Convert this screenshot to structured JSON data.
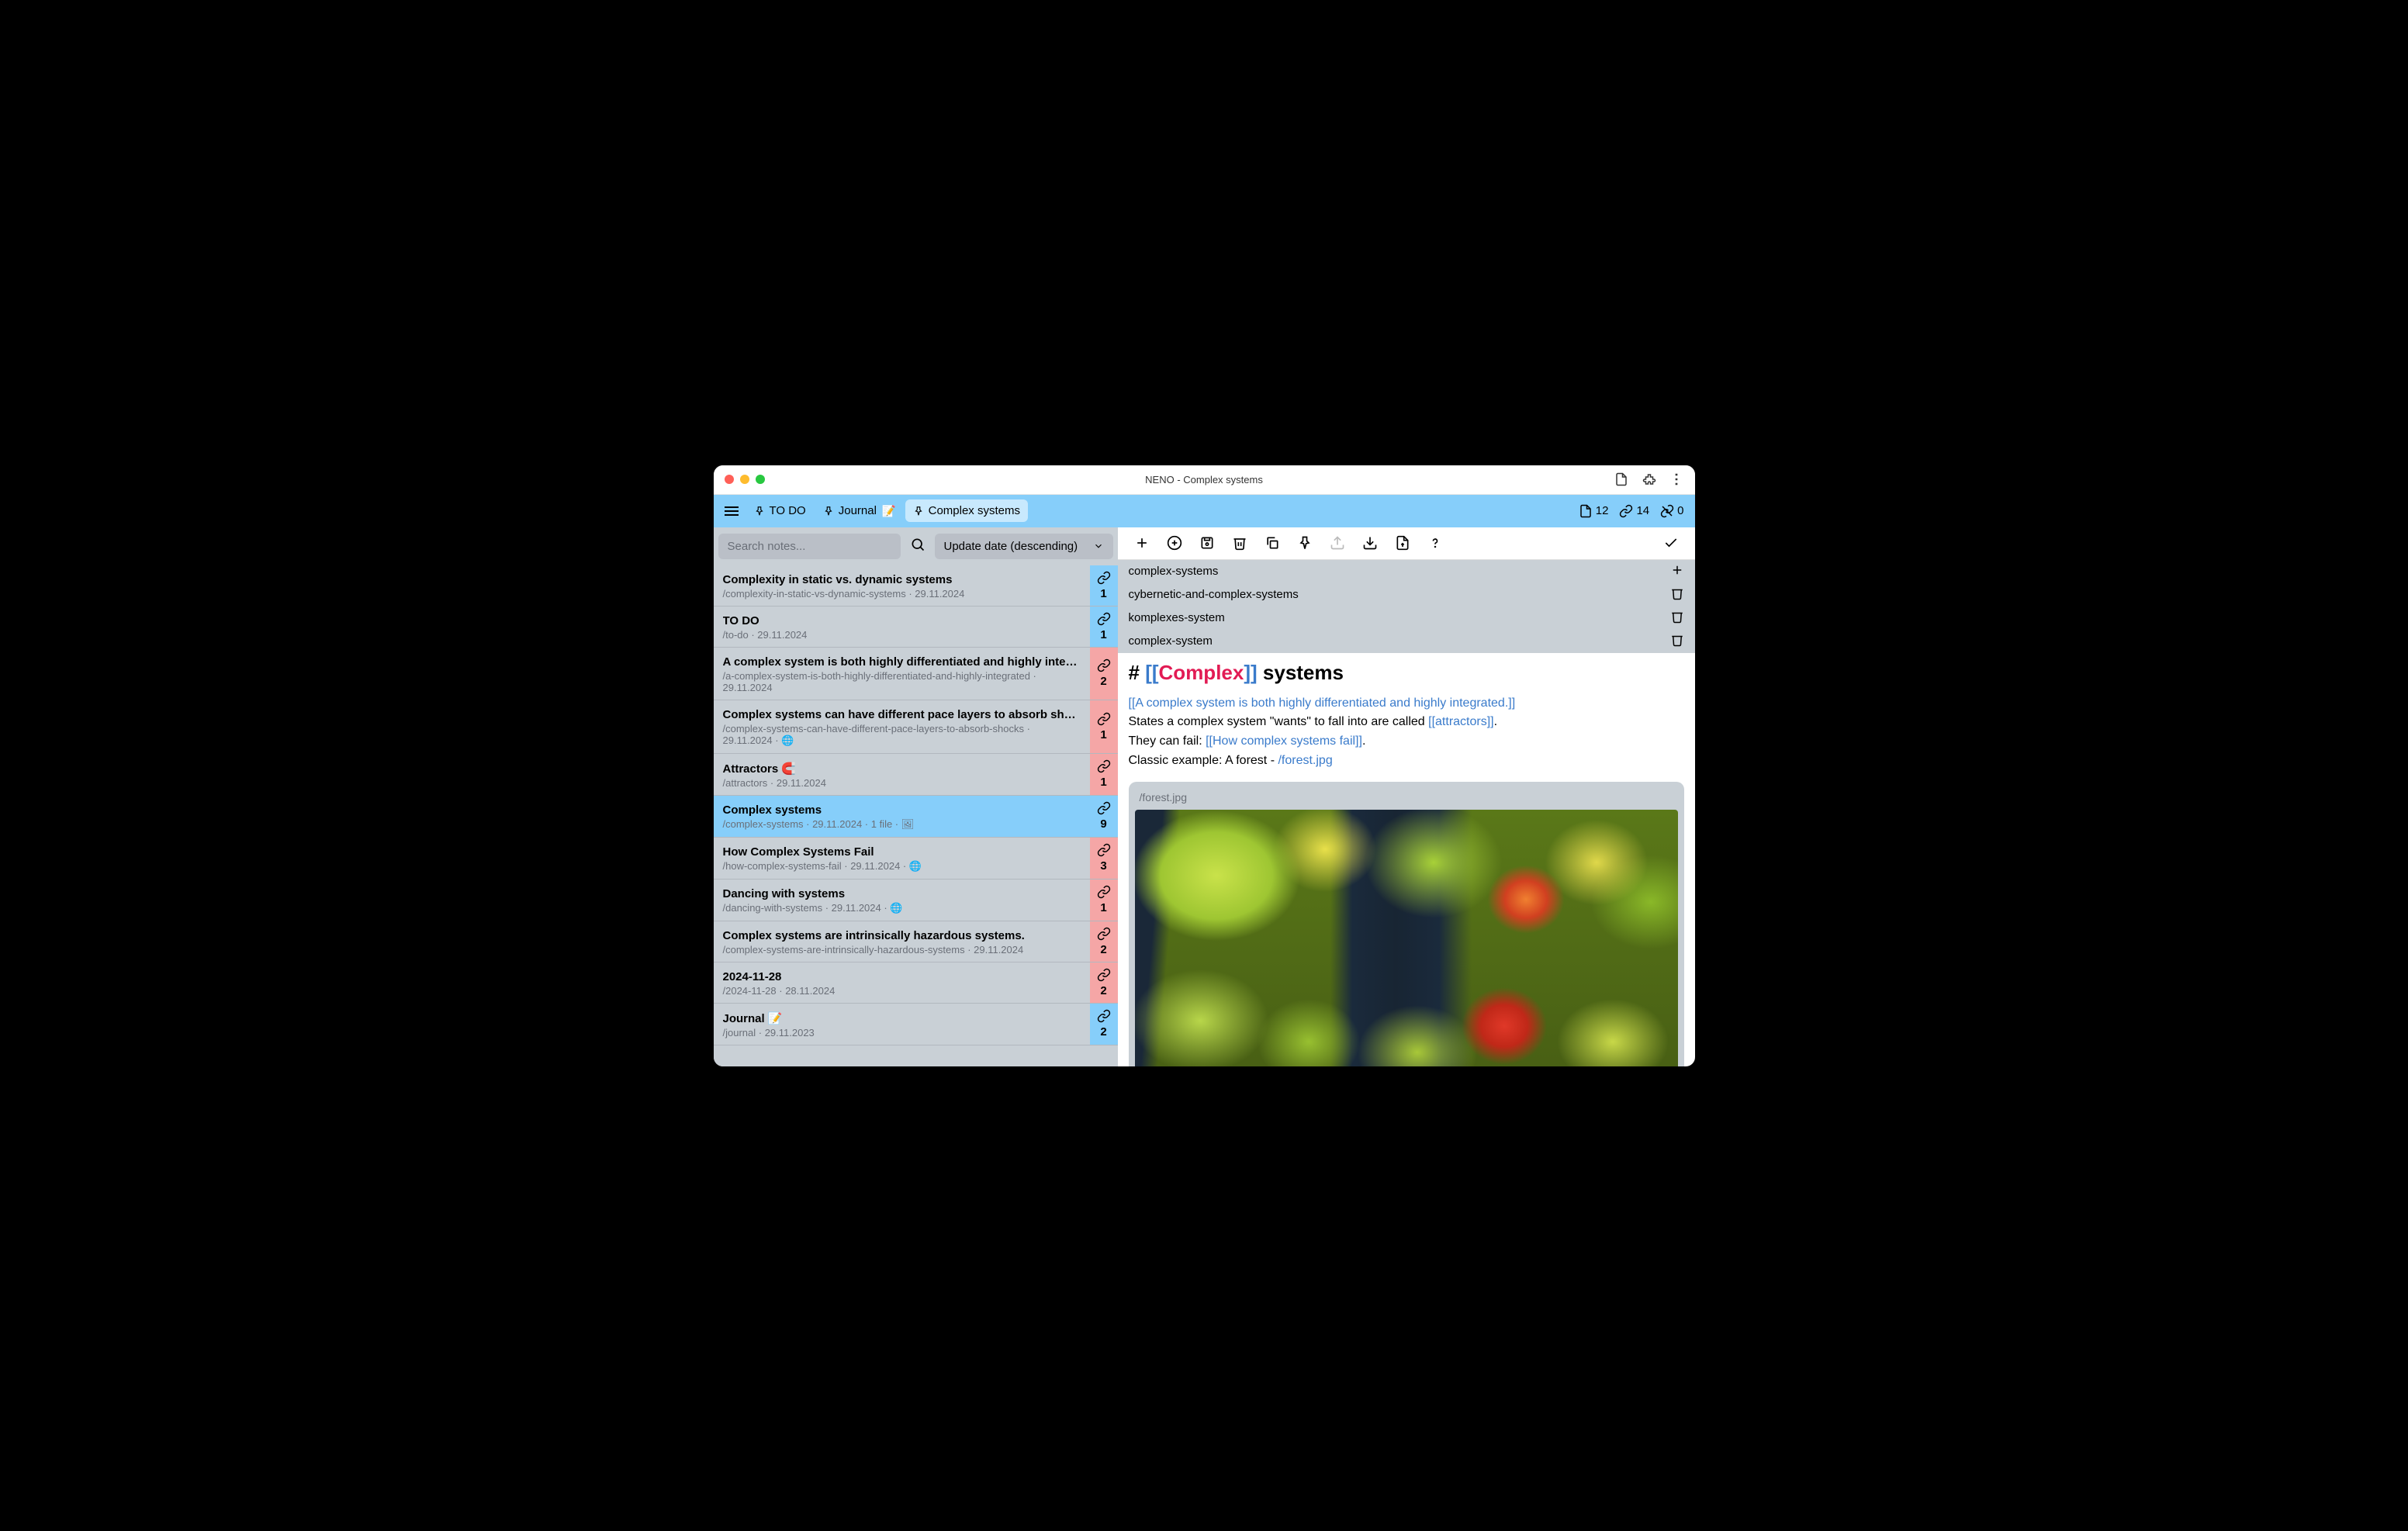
{
  "window_title": "NENO - Complex systems",
  "header": {
    "pins": [
      {
        "label": "TO DO",
        "emoji": ""
      },
      {
        "label": "Journal",
        "emoji": "📝"
      },
      {
        "label": "Complex systems",
        "emoji": "",
        "active": true
      }
    ],
    "stats": {
      "notes": "12",
      "links": "14",
      "broken": "0"
    }
  },
  "search": {
    "placeholder": "Search notes..."
  },
  "sort": {
    "label": "Update date (descending)"
  },
  "notes": [
    {
      "title": "Complexity in static vs. dynamic systems",
      "meta": "/complexity-in-static-vs-dynamic-systems · 29.11.2024",
      "count": "1",
      "badge": "blue"
    },
    {
      "title": "TO DO",
      "meta": "/to-do · 29.11.2024",
      "count": "1",
      "badge": "blue"
    },
    {
      "title": "A complex system is both highly differentiated and highly integrat...",
      "meta": "/a-complex-system-is-both-highly-differentiated-and-highly-integrated · 29.11.2024",
      "count": "2",
      "badge": "red"
    },
    {
      "title": "Complex systems can have different pace layers to absorb shocks.",
      "meta": "/complex-systems-can-have-different-pace-layers-to-absorb-shocks · 29.11.2024 · 🌐",
      "count": "1",
      "badge": "red"
    },
    {
      "title": "Attractors 🧲",
      "meta": "/attractors · 29.11.2024",
      "count": "1",
      "badge": "red"
    },
    {
      "title": "Complex systems",
      "meta": "/complex-systems · 29.11.2024 · 1 file · 🖼",
      "count": "9",
      "badge": "blue",
      "active": true
    },
    {
      "title": "How Complex Systems Fail",
      "meta": "/how-complex-systems-fail · 29.11.2024 · 🌐",
      "count": "3",
      "badge": "red"
    },
    {
      "title": "Dancing with systems",
      "meta": "/dancing-with-systems · 29.11.2024 · 🌐",
      "count": "1",
      "badge": "red"
    },
    {
      "title": "Complex systems are intrinsically hazardous systems.",
      "meta": "/complex-systems-are-intrinsically-hazardous-systems · 29.11.2024",
      "count": "2",
      "badge": "red"
    },
    {
      "title": "2024-11-28",
      "meta": "/2024-11-28 · 28.11.2024",
      "count": "2",
      "badge": "red"
    },
    {
      "title": "Journal 📝",
      "meta": "/journal · 29.11.2023",
      "count": "2",
      "badge": "blue"
    }
  ],
  "aliases": [
    {
      "name": "complex-systems",
      "action": "add"
    },
    {
      "name": "cybernetic-and-complex-systems",
      "action": "delete"
    },
    {
      "name": "komplexes-system",
      "action": "delete"
    },
    {
      "name": "complex-system",
      "action": "delete"
    }
  ],
  "editor": {
    "h1_prefix": "#",
    "h1_brackets_open": "[[",
    "h1_link": "Complex",
    "h1_brackets_close": "]]",
    "h1_rest": " systems",
    "line1_open": "[[",
    "line1_link": "A complex system is both highly differentiated and highly integrated.",
    "line1_close": "]]",
    "line2_a": "States a complex system \"wants\" to fall into are called ",
    "line2_open": "[[",
    "line2_link": "attractors",
    "line2_close": "]]",
    "line2_end": ".",
    "line3_a": "They can fail: ",
    "line3_open": "[[",
    "line3_link": "How complex systems fail",
    "line3_close": "]]",
    "line3_end": ".",
    "line4_a": "Classic example: A forest - ",
    "line4_link": "/forest.jpg",
    "image_caption": "/forest.jpg"
  }
}
